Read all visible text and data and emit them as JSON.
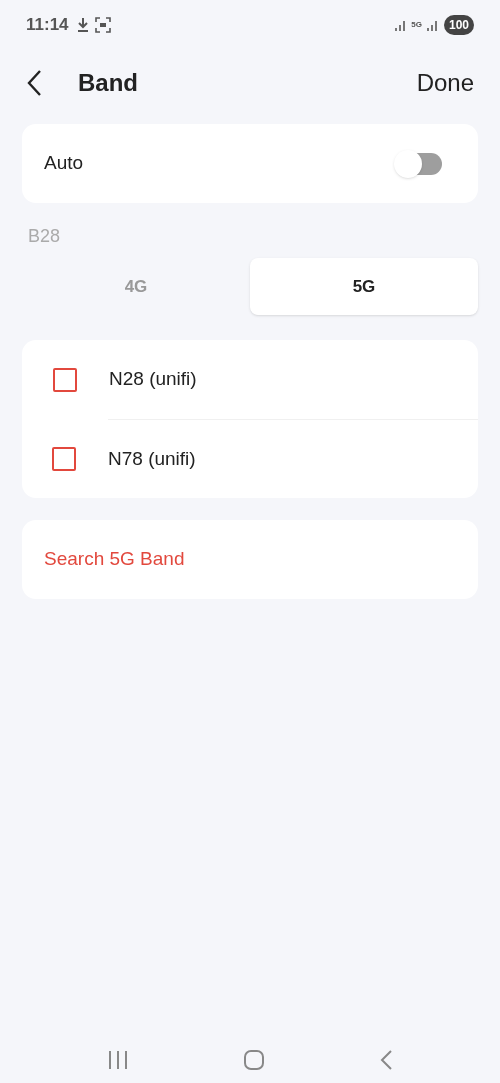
{
  "status_bar": {
    "time": "11:14",
    "network": "5G",
    "battery": "100"
  },
  "header": {
    "title": "Band",
    "action": "Done"
  },
  "auto": {
    "label": "Auto",
    "on": false
  },
  "section_label": "B28",
  "tabs": [
    {
      "label": "4G",
      "selected": false
    },
    {
      "label": "5G",
      "selected": true
    }
  ],
  "bands": [
    {
      "label": "N28 (unifi)",
      "checked": false
    },
    {
      "label": "N78 (unifi)",
      "checked": false
    }
  ],
  "search_button": "Search 5G Band"
}
